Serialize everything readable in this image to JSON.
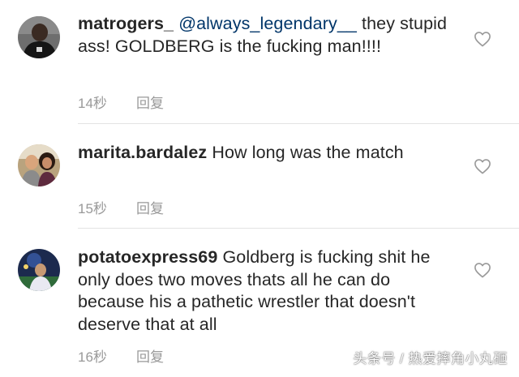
{
  "comments": [
    {
      "username": "matrogers_",
      "mention": "@always_legendary__",
      "text": "they stupid ass! GOLDBERG is the fucking man!!!!",
      "time": "14秒",
      "reply": "回复",
      "avatar_icon": "avatar-dark-shirt-icon"
    },
    {
      "username": "marita.bardalez",
      "text": "How long was the match",
      "time": "15秒",
      "reply": "回复",
      "avatar_icon": "avatar-couple-photo-icon"
    },
    {
      "username": "potatoexpress69",
      "text": "Goldberg is fucking shit he only does two moves thats all he can do because his a pathetic wrestler that doesn't deserve that at all",
      "time": "16秒",
      "reply": "回复",
      "avatar_icon": "avatar-night-photo-icon"
    }
  ],
  "watermark": "头条号 / 热爱摔角小丸砸",
  "colors": {
    "text": "#262626",
    "mention": "#003569",
    "meta": "#999999",
    "divider": "#e3e3e3",
    "heart_stroke": "#999999"
  }
}
